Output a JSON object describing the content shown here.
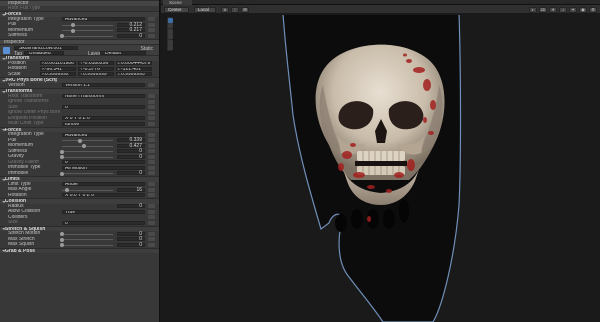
{
  "inspector": {
    "top_rows": [
      {
        "label": "Inspector",
        "type": "header"
      },
      {
        "label": "Root Full Type",
        "type": "dim"
      }
    ],
    "psone": {
      "section": "Forces",
      "rows": [
        {
          "label": "Integration Type",
          "value": "Advanced",
          "type": "dropdown"
        },
        {
          "label": "Pull",
          "value": "0.212",
          "slider": 0.212,
          "type": "slider"
        },
        {
          "label": "Momentum",
          "value": "0.217",
          "slider": 0.217,
          "type": "slider"
        },
        {
          "label": "Stiffness",
          "value": "0",
          "slider": 0,
          "type": "slider"
        }
      ]
    },
    "inspector_tab": "Inspector",
    "object": {
      "name": "SkullHand.Low.001",
      "static_label": "Static",
      "tag_label": "Tag",
      "tag_value": "Untagged",
      "layer_label": "Layer",
      "layer_value": "Default"
    },
    "transform": {
      "title": "Transform",
      "rows": [
        {
          "label": "Position",
          "x": "0.001101986",
          "y": "-0.0180296",
          "z": "0.000444579"
        },
        {
          "label": "Rotation",
          "x": "-90.541",
          "y": "-0.3776",
          "z": "-121.401"
        },
        {
          "label": "Scale",
          "x": "0.9999992",
          "y": "0.9999999",
          "z": "0.9999995"
        }
      ]
    },
    "physbone": {
      "title": "VRC Phys Bone (Script)",
      "version_label": "Version",
      "version_value": "Version 1.1",
      "sections": [
        {
          "title": "Transforms",
          "rows": [
            {
              "label": "Root Transform",
              "value": "None (Transform)",
              "type": "dim"
            },
            {
              "label": "Ignore Transforms",
              "value": "",
              "type": "dim"
            },
            {
              "label": "Size",
              "value": "0",
              "type": "dim"
            },
            {
              "label": "Ignore Other Phys Bones",
              "value": "",
              "type": "dim"
            },
            {
              "label": "Endpoint Position",
              "value": "X  0    Y  0    Z  0",
              "type": "dim"
            },
            {
              "label": "Multi Child Type",
              "value": "Ignore",
              "type": "dim"
            }
          ]
        },
        {
          "title": "Forces",
          "rows": [
            {
              "label": "Integration Type",
              "value": "Advanced",
              "type": "dropdown"
            },
            {
              "label": "Pull",
              "value": "0.339",
              "slider": 0.339,
              "type": "slider"
            },
            {
              "label": "Momentum",
              "value": "0.427",
              "slider": 0.427,
              "type": "slider"
            },
            {
              "label": "Stiffness",
              "value": "0",
              "slider": 0,
              "type": "slider"
            },
            {
              "label": "Gravity",
              "value": "0",
              "slider": 0,
              "type": "slider"
            },
            {
              "label": "Gravity Falloff",
              "value": "0",
              "slider": 0,
              "type": "dim"
            },
            {
              "label": "Immobile Type",
              "value": "All Motion",
              "type": "dropdown"
            },
            {
              "label": "Immobile",
              "value": "0",
              "slider": 0,
              "type": "slider"
            }
          ]
        },
        {
          "title": "Limits",
          "rows": [
            {
              "label": "Limit Type",
              "value": "Angle",
              "type": "dropdown"
            },
            {
              "label": "Max Angle",
              "value": "16",
              "slider": 0.09,
              "type": "slider"
            },
            {
              "label": "Rotation",
              "value": "X 0.0    Y 0    Z 0",
              "type": "vecline"
            }
          ]
        },
        {
          "title": "Collision",
          "rows": [
            {
              "label": "Radius",
              "value": "0",
              "type": "num"
            },
            {
              "label": "Allow Collision",
              "value": "True",
              "type": "dropdown"
            },
            {
              "label": "Colliders",
              "value": "",
              "type": "text"
            },
            {
              "label": "Size",
              "value": "0",
              "type": "dim"
            }
          ]
        },
        {
          "title": "Stretch & Squish",
          "rows": [
            {
              "label": "Stretch Motion",
              "value": "0",
              "slider": 0,
              "type": "slider"
            },
            {
              "label": "Max Stretch",
              "value": "0",
              "slider": 0,
              "type": "slider"
            },
            {
              "label": "Max Squish",
              "value": "0",
              "slider": 0,
              "type": "slider"
            }
          ]
        },
        {
          "title": "Grab & Pose",
          "rows": []
        }
      ]
    }
  },
  "scene": {
    "tab": "Scene",
    "shading_mode": "Center",
    "space_mode": "Local",
    "view_2d": "2D",
    "persp": "Persp"
  },
  "colors": {
    "outline": "#6f8fb8",
    "panel": "#383838",
    "viewport": "#1a1a1a"
  }
}
